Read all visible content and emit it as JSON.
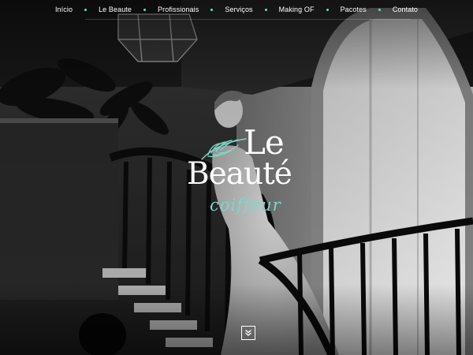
{
  "nav": {
    "items": [
      {
        "label": "Início"
      },
      {
        "label": "Le Beaute"
      },
      {
        "label": "Profissionais"
      },
      {
        "label": "Serviços"
      },
      {
        "label": "Making OF"
      },
      {
        "label": "Pacotes"
      },
      {
        "label": "Contato"
      }
    ],
    "separator_color": "#7fd6c8"
  },
  "logo": {
    "line1": "Le",
    "line2": "Beauté",
    "tagline": "coiffeur",
    "accent_color": "#7fd6c8",
    "icon": "feather-icon"
  },
  "hero": {
    "image": "bride-on-staircase-photo"
  },
  "scroll_button": {
    "icon": "double-chevron-down-icon"
  }
}
